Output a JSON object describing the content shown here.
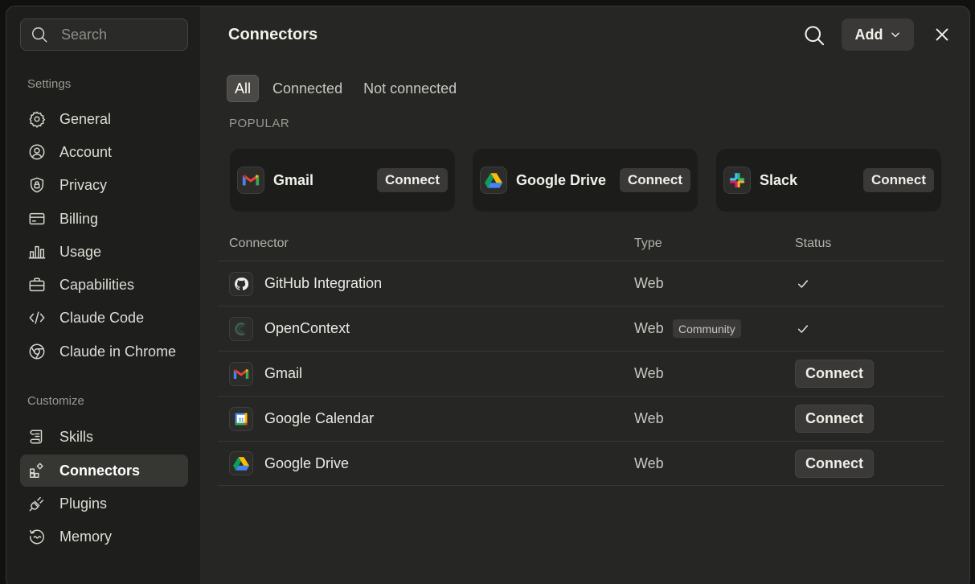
{
  "sidebar": {
    "search_placeholder": "Search",
    "settings_label": "Settings",
    "settings_items": [
      {
        "label": "General",
        "icon": "gear-icon"
      },
      {
        "label": "Account",
        "icon": "user-circle-icon"
      },
      {
        "label": "Privacy",
        "icon": "shield-lock-icon"
      },
      {
        "label": "Billing",
        "icon": "credit-card-icon"
      },
      {
        "label": "Usage",
        "icon": "bar-chart-icon"
      },
      {
        "label": "Capabilities",
        "icon": "briefcase-icon"
      },
      {
        "label": "Claude Code",
        "icon": "code-icon"
      },
      {
        "label": "Claude in Chrome",
        "icon": "chrome-icon"
      }
    ],
    "customize_label": "Customize",
    "customize_items": [
      {
        "label": "Skills",
        "icon": "scroll-icon"
      },
      {
        "label": "Connectors",
        "icon": "connectors-icon",
        "active": true
      },
      {
        "label": "Plugins",
        "icon": "plug-icon"
      },
      {
        "label": "Memory",
        "icon": "memory-icon"
      }
    ]
  },
  "main": {
    "title": "Connectors",
    "add_label": "Add",
    "tabs": [
      {
        "label": "All",
        "active": true
      },
      {
        "label": "Connected"
      },
      {
        "label": "Not connected"
      }
    ],
    "popular_label": "POPULAR",
    "popular": [
      {
        "name": "Gmail",
        "icon": "gmail-icon",
        "action": "Connect"
      },
      {
        "name": "Google Drive",
        "icon": "google-drive-icon",
        "action": "Connect"
      },
      {
        "name": "Slack",
        "icon": "slack-icon",
        "action": "Connect"
      }
    ],
    "table": {
      "headers": {
        "connector": "Connector",
        "type": "Type",
        "status": "Status"
      },
      "rows": [
        {
          "name": "GitHub Integration",
          "icon": "github-icon",
          "type": "Web",
          "badge": "",
          "status": "connected"
        },
        {
          "name": "OpenContext",
          "icon": "opencontext-icon",
          "type": "Web",
          "badge": "Community",
          "status": "connected"
        },
        {
          "name": "Gmail",
          "icon": "gmail-icon",
          "type": "Web",
          "badge": "",
          "status": "Connect"
        },
        {
          "name": "Google Calendar",
          "icon": "google-calendar-icon",
          "type": "Web",
          "badge": "",
          "status": "Connect"
        },
        {
          "name": "Google Drive",
          "icon": "google-drive-icon",
          "type": "Web",
          "badge": "",
          "status": "Connect"
        }
      ]
    }
  },
  "calendar_icon_text": "31"
}
